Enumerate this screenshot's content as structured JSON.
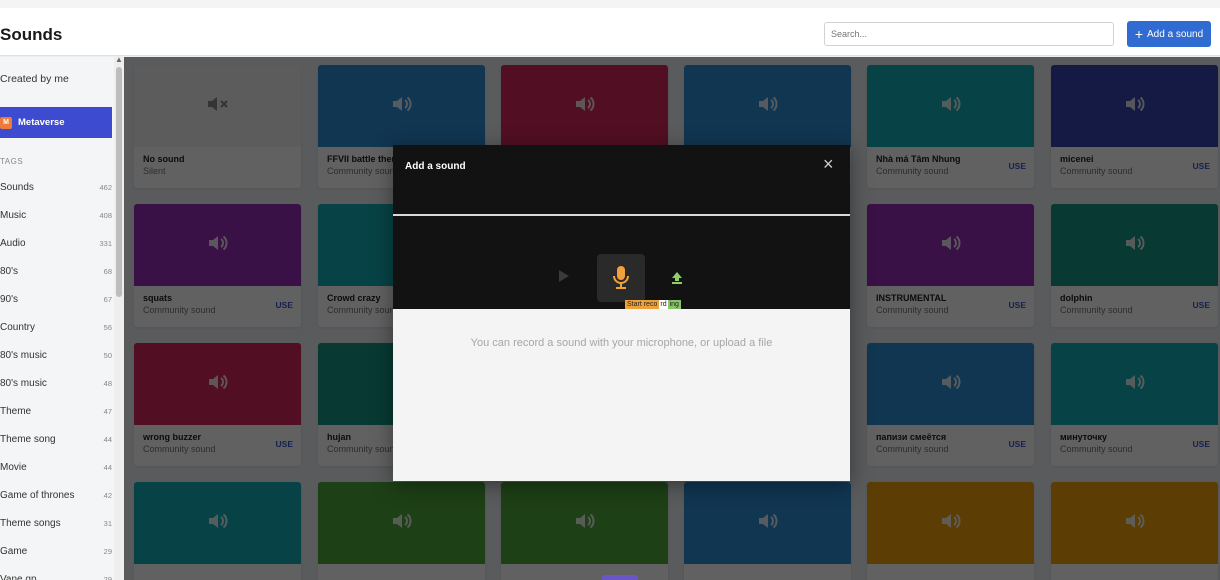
{
  "header": {
    "title": "Sounds",
    "search_placeholder": "Search...",
    "add_label": "Add a sound"
  },
  "sidebar": {
    "created_label": "Created by me",
    "metaverse_label": "Metaverse",
    "tags_heading": "TAGS",
    "tags": [
      {
        "label": "Sounds",
        "count": "462"
      },
      {
        "label": "Music",
        "count": "408"
      },
      {
        "label": "Audio",
        "count": "331"
      },
      {
        "label": "80's",
        "count": "68"
      },
      {
        "label": "90's",
        "count": "67"
      },
      {
        "label": "Country",
        "count": "56"
      },
      {
        "label": "80's music",
        "count": "50"
      },
      {
        "label": "80's music",
        "count": "48"
      },
      {
        "label": "Theme",
        "count": "47"
      },
      {
        "label": "Theme song",
        "count": "44"
      },
      {
        "label": "Movie",
        "count": "44"
      },
      {
        "label": "Game of thrones",
        "count": "42"
      },
      {
        "label": "Theme songs",
        "count": "31"
      },
      {
        "label": "Game",
        "count": "29"
      },
      {
        "label": "Vane gp",
        "count": "29"
      }
    ]
  },
  "cards": [
    {
      "name": "No sound",
      "sub": "Silent",
      "use": "",
      "color": "#f2f2f2",
      "icon": "mute-icon"
    },
    {
      "name": "FFVII battle theme",
      "sub": "Community sound",
      "use": "",
      "color": "#2f8fd8",
      "icon": "speaker-icon"
    },
    {
      "name": "",
      "sub": "",
      "use": "",
      "color": "#d8285d",
      "icon": "speaker-icon"
    },
    {
      "name": "",
      "sub": "",
      "use": "",
      "color": "#2f8fd8",
      "icon": "speaker-icon"
    },
    {
      "name": "Nhà má Tâm Nhung",
      "sub": "Community sound",
      "use": "USE",
      "color": "#14b1b8",
      "icon": "speaker-icon"
    },
    {
      "name": "micenei",
      "sub": "Community sound",
      "use": "USE",
      "color": "#3746b6",
      "icon": "speaker-icon"
    },
    {
      "name": "squats",
      "sub": "Community sound",
      "use": "USE",
      "color": "#9a2fb8",
      "icon": "speaker-icon"
    },
    {
      "name": "Crowd crazy",
      "sub": "Community sound",
      "use": "",
      "color": "#14b1b8",
      "icon": "speaker-icon"
    },
    {
      "name": "INSTRUMENTAL",
      "sub": "Community sound",
      "use": "USE",
      "color": "#9a2fb8",
      "icon": "speaker-icon"
    },
    {
      "name": "dolphin",
      "sub": "Community sound",
      "use": "USE",
      "color": "#169a86",
      "icon": "speaker-icon"
    },
    {
      "name": "wrong buzzer",
      "sub": "Community sound",
      "use": "USE",
      "color": "#d8285d",
      "icon": "speaker-icon"
    },
    {
      "name": "hujan",
      "sub": "Community sound",
      "use": "",
      "color": "#169a86",
      "icon": "speaker-icon"
    },
    {
      "name": "папизи смеётся",
      "sub": "Community sound",
      "use": "USE",
      "color": "#2f8fd8",
      "icon": "speaker-icon"
    },
    {
      "name": "минуточку",
      "sub": "Community sound",
      "use": "USE",
      "color": "#14b1b8",
      "icon": "speaker-icon"
    },
    {
      "name": "",
      "sub": "",
      "use": "",
      "color": "#14b1b8",
      "icon": "speaker-icon"
    },
    {
      "name": "",
      "sub": "",
      "use": "",
      "color": "#4fa83a",
      "icon": "speaker-icon"
    },
    {
      "name": "",
      "sub": "",
      "use": "",
      "color": "#4fa83a",
      "icon": "speaker-icon"
    },
    {
      "name": "",
      "sub": "",
      "use": "",
      "color": "#2f8fd8",
      "icon": "speaker-icon"
    },
    {
      "name": "",
      "sub": "",
      "use": "",
      "color": "#f2a10c",
      "icon": "speaker-icon"
    },
    {
      "name": "",
      "sub": "",
      "use": "",
      "color": "#f2a10c",
      "icon": "speaker-icon"
    }
  ],
  "modal": {
    "title": "Add a sound",
    "close_glyph": "×",
    "tooltip_a": "Start reco",
    "tooltip_b": "rd",
    "tooltip_c": "ing",
    "hint": "You can record a sound with your microphone, or upload a file",
    "mic_color": "#f0a23a",
    "upload_color": "#8fcf6a"
  }
}
